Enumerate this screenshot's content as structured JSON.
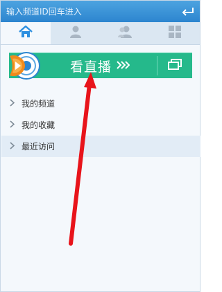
{
  "search": {
    "placeholder": "输入频道ID回车进入",
    "enter_icon": "enter-return-icon"
  },
  "tabs": [
    {
      "icon": "home-icon",
      "active": true
    },
    {
      "icon": "user-icon",
      "active": false
    },
    {
      "icon": "users-icon",
      "active": false
    },
    {
      "icon": "grid-icon",
      "active": false
    }
  ],
  "banner": {
    "label": "看直播",
    "arrows_icon": "double-chevron-right-icon",
    "popout_icon": "popout-window-icon",
    "logo_icon": "app-logo-icon"
  },
  "list": {
    "items": [
      {
        "label": "我的频道",
        "selected": false
      },
      {
        "label": "我的收藏",
        "selected": false
      },
      {
        "label": "最近访问",
        "selected": true
      }
    ]
  },
  "colors": {
    "accent_blue": "#2c85cf",
    "banner_green": "#25b98b",
    "annotation_red": "#e8141b"
  }
}
